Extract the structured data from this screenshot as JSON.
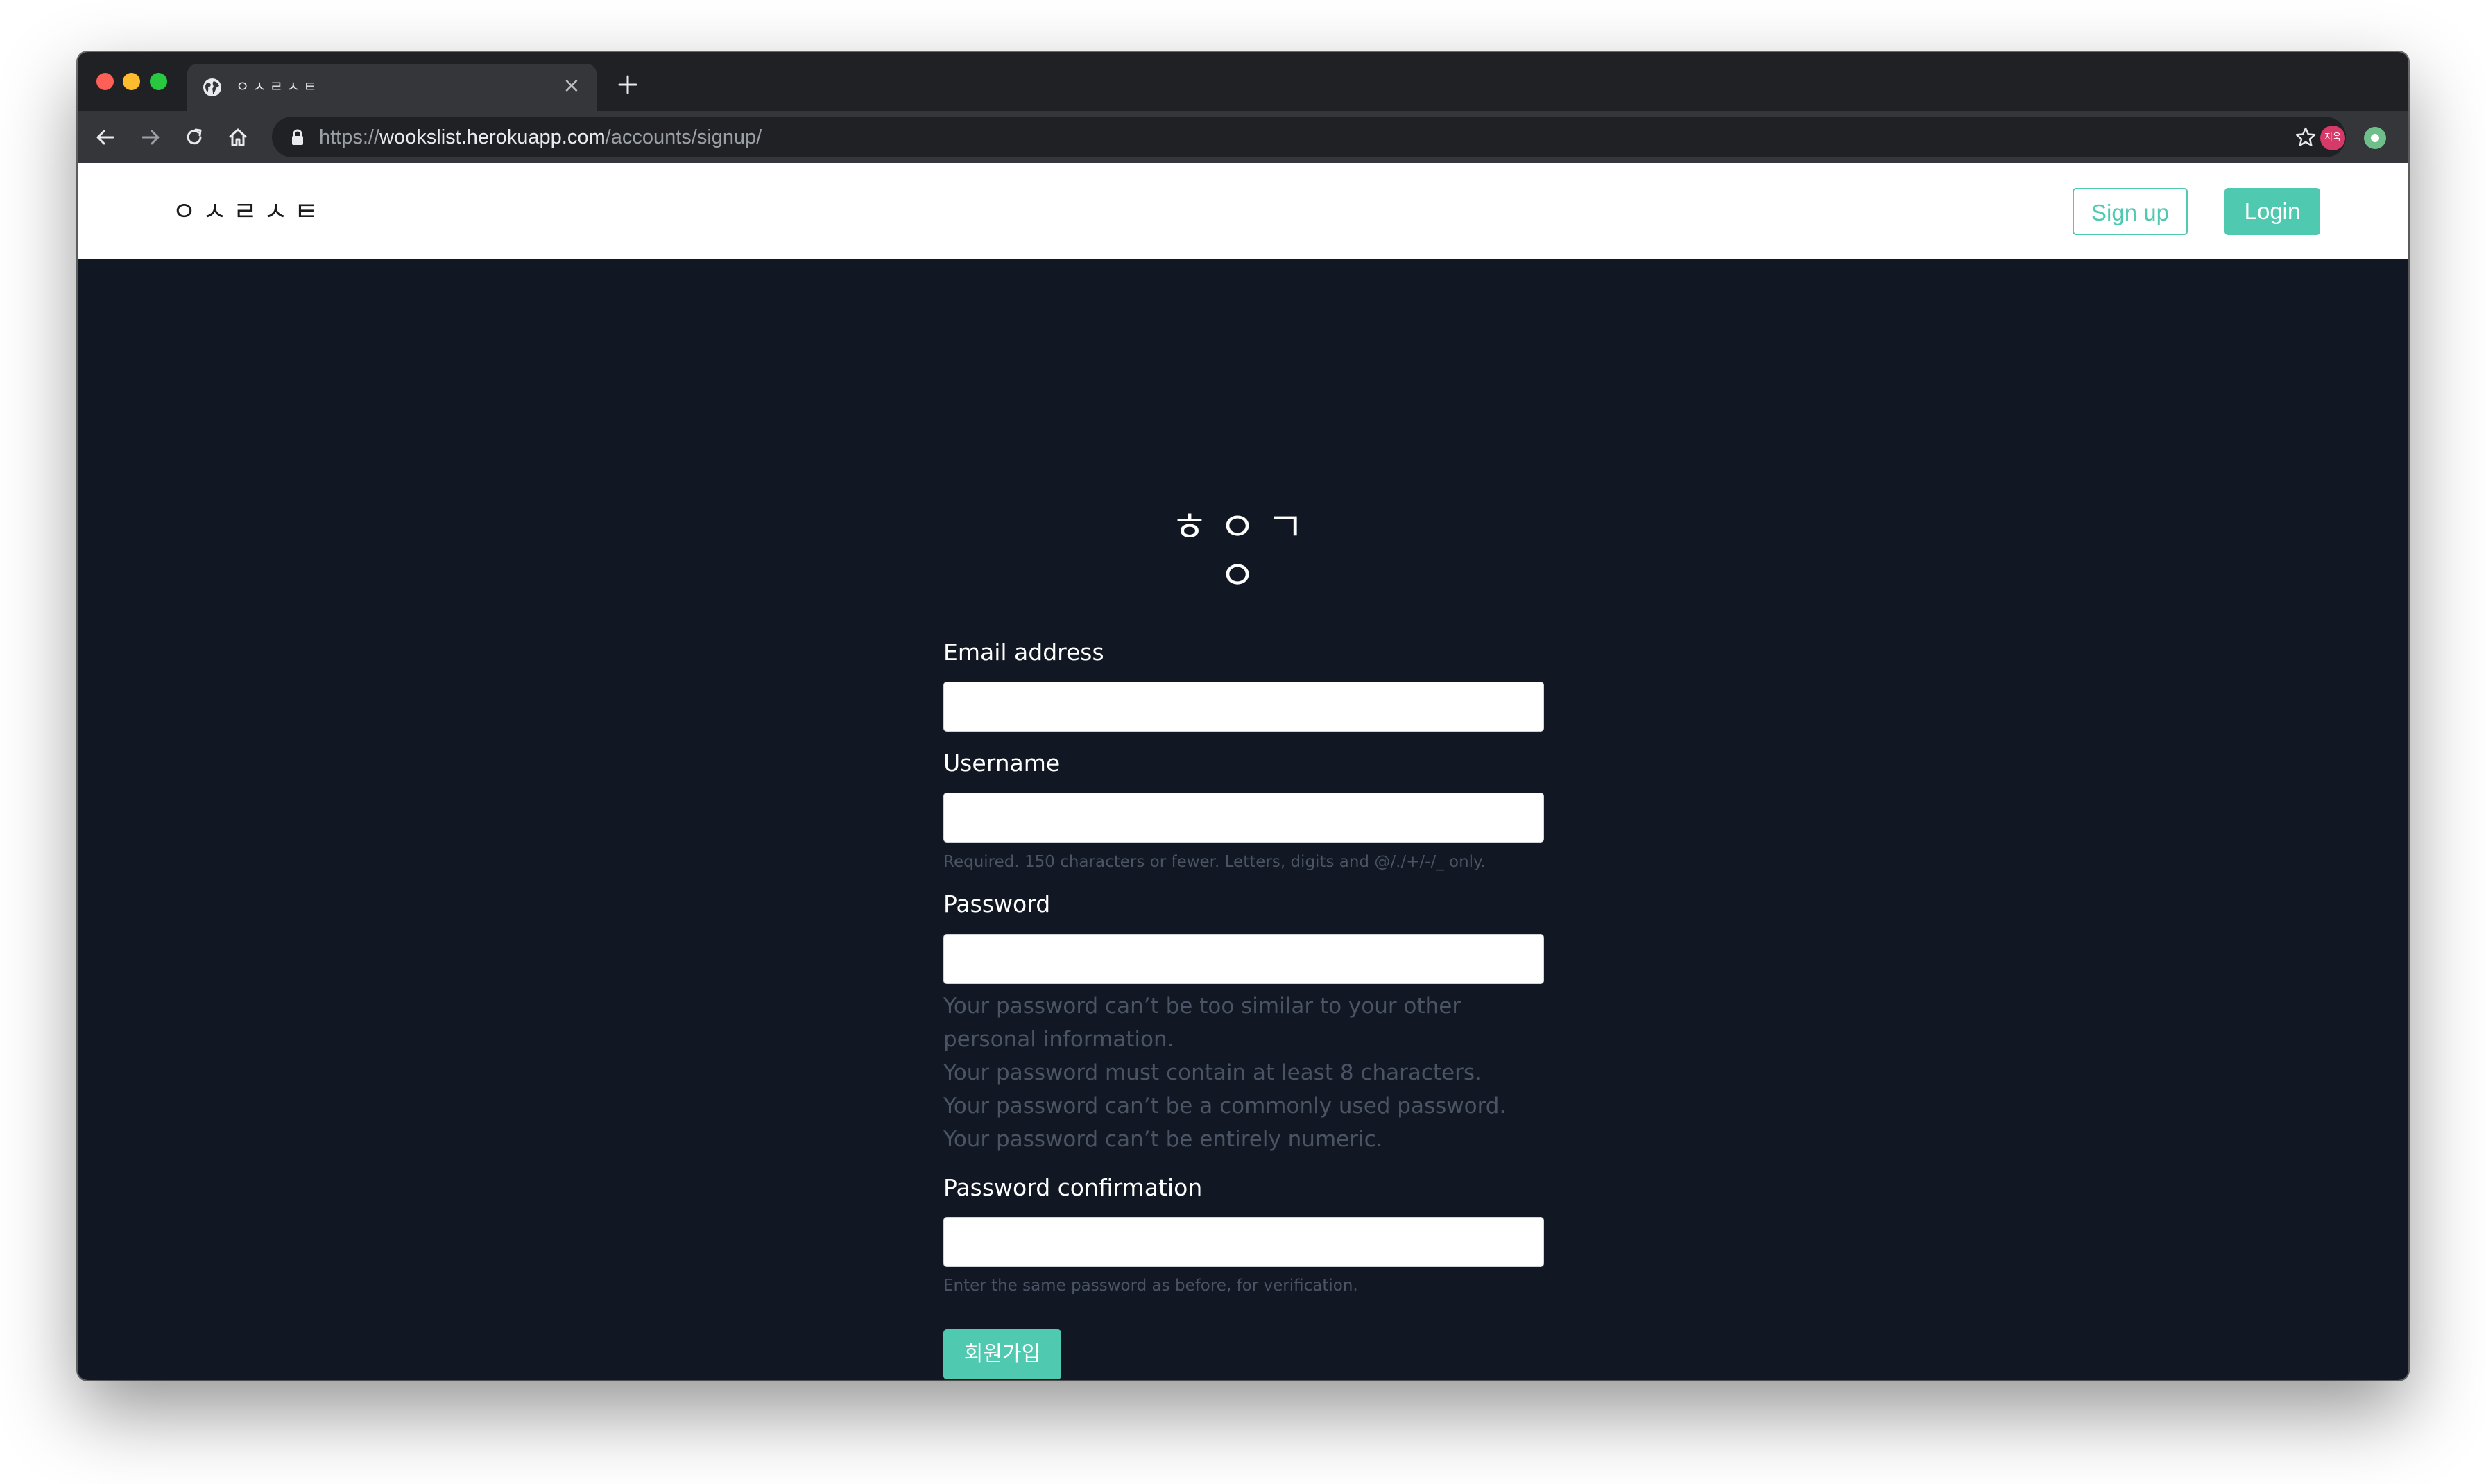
{
  "browser": {
    "tab_title": "ㅇㅅㄹㅅㅌ",
    "url_scheme": "https://",
    "url_host": "wookslist.herokuapp.com",
    "url_path": "/accounts/signup/",
    "profile_initials": "지욱",
    "colors": {
      "tabstrip": "#202124",
      "toolbar": "#35363a"
    }
  },
  "navbar": {
    "brand": "ㅇㅅㄹㅅㅌ",
    "signup_label": "Sign up",
    "login_label": "Login"
  },
  "form": {
    "logo": "ㅎㅇㄱㅇ",
    "email_label": "Email address",
    "email_value": "",
    "username_label": "Username",
    "username_value": "",
    "username_help": "Required. 150 characters or fewer. Letters, digits and @/./+/-/_ only.",
    "password_label": "Password",
    "password_value": "",
    "password_help": [
      "Your password can’t be too similar to your other",
      "personal information.",
      "Your password must contain at least 8 characters.",
      "Your password can’t be a commonly used password.",
      "Your password can’t be entirely numeric."
    ],
    "password2_label": "Password confirmation",
    "password2_value": "",
    "password2_help": "Enter the same password as before, for verification.",
    "submit_label": "회원가입"
  },
  "colors": {
    "accent": "#4fcab0",
    "page_background": "#111823",
    "help_text": "#4a5464"
  }
}
